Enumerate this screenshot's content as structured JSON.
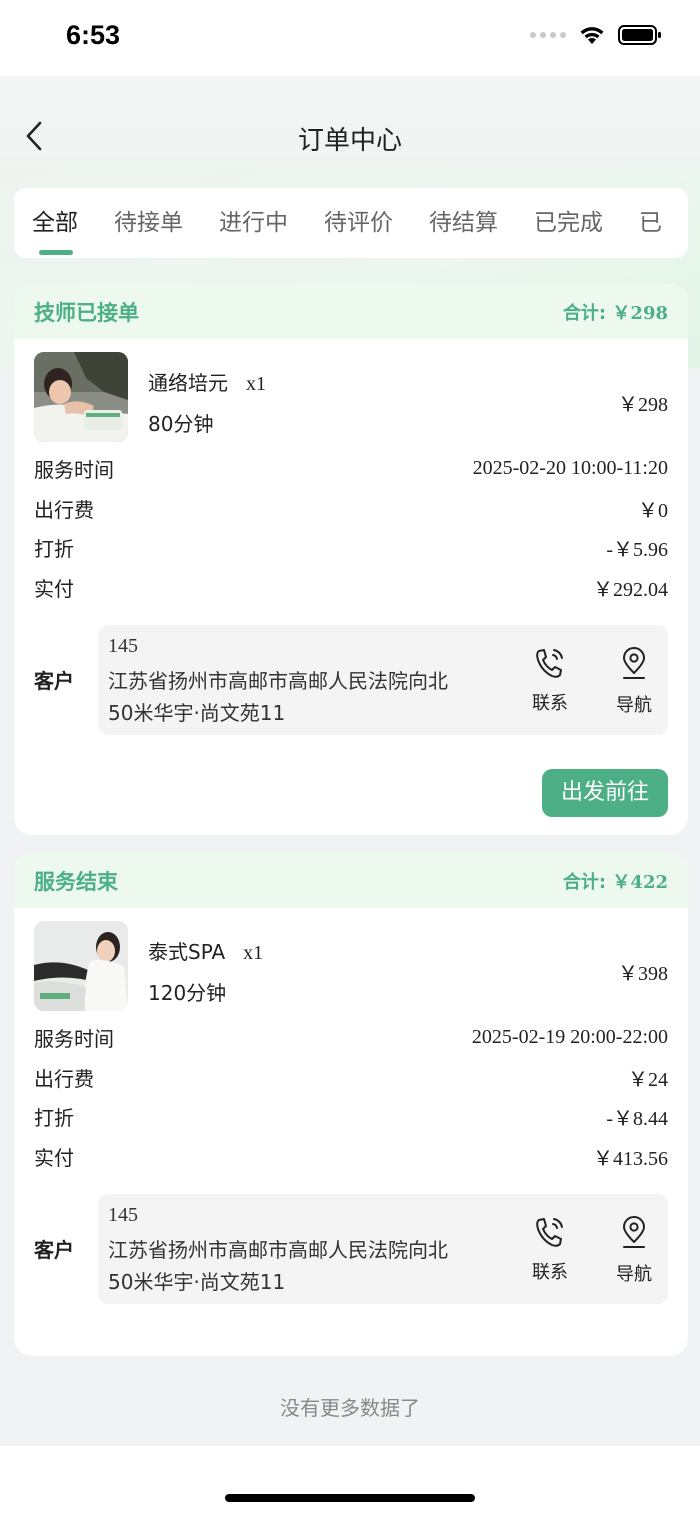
{
  "status_bar": {
    "time": "6:53"
  },
  "nav": {
    "title": "订单中心"
  },
  "tabs": [
    {
      "label": "全部",
      "active": true
    },
    {
      "label": "待接单"
    },
    {
      "label": "进行中"
    },
    {
      "label": "待评价"
    },
    {
      "label": "待结算"
    },
    {
      "label": "已完成"
    },
    {
      "label": "已"
    }
  ],
  "colors": {
    "accent": "#4caf85",
    "header_bg": "#edf9ef"
  },
  "orders": [
    {
      "status": "技师已接单",
      "total_label": "合计:",
      "total": "￥298",
      "item": {
        "name": "通络培元",
        "qty": "x1",
        "duration": "80分钟",
        "price": "￥298"
      },
      "rows": [
        {
          "label": "服务时间",
          "value": "2025-02-20 10:00-11:20"
        },
        {
          "label": "出行费",
          "value": "￥0"
        },
        {
          "label": "打折",
          "value": "-￥5.96"
        },
        {
          "label": "实付",
          "value": "￥292.04"
        }
      ],
      "customer": {
        "label": "客户",
        "phone": "145",
        "address_line1": "江苏省扬州市高邮市高邮人民法院向北",
        "address_line2": "50米华宇·尚文苑11",
        "contact_label": "联系",
        "navigate_label": "导航"
      },
      "action_label": "出发前往"
    },
    {
      "status": "服务结束",
      "total_label": "合计:",
      "total": "￥422",
      "item": {
        "name": "泰式SPA",
        "qty": "x1",
        "duration": "120分钟",
        "price": "￥398"
      },
      "rows": [
        {
          "label": "服务时间",
          "value": "2025-02-19 20:00-22:00"
        },
        {
          "label": "出行费",
          "value": "￥24"
        },
        {
          "label": "打折",
          "value": "-￥8.44"
        },
        {
          "label": "实付",
          "value": "￥413.56"
        }
      ],
      "customer": {
        "label": "客户",
        "phone": "145",
        "address_line1": "江苏省扬州市高邮市高邮人民法院向北",
        "address_line2": "50米华宇·尚文苑11",
        "contact_label": "联系",
        "navigate_label": "导航"
      }
    }
  ],
  "footer": {
    "no_more": "没有更多数据了"
  }
}
